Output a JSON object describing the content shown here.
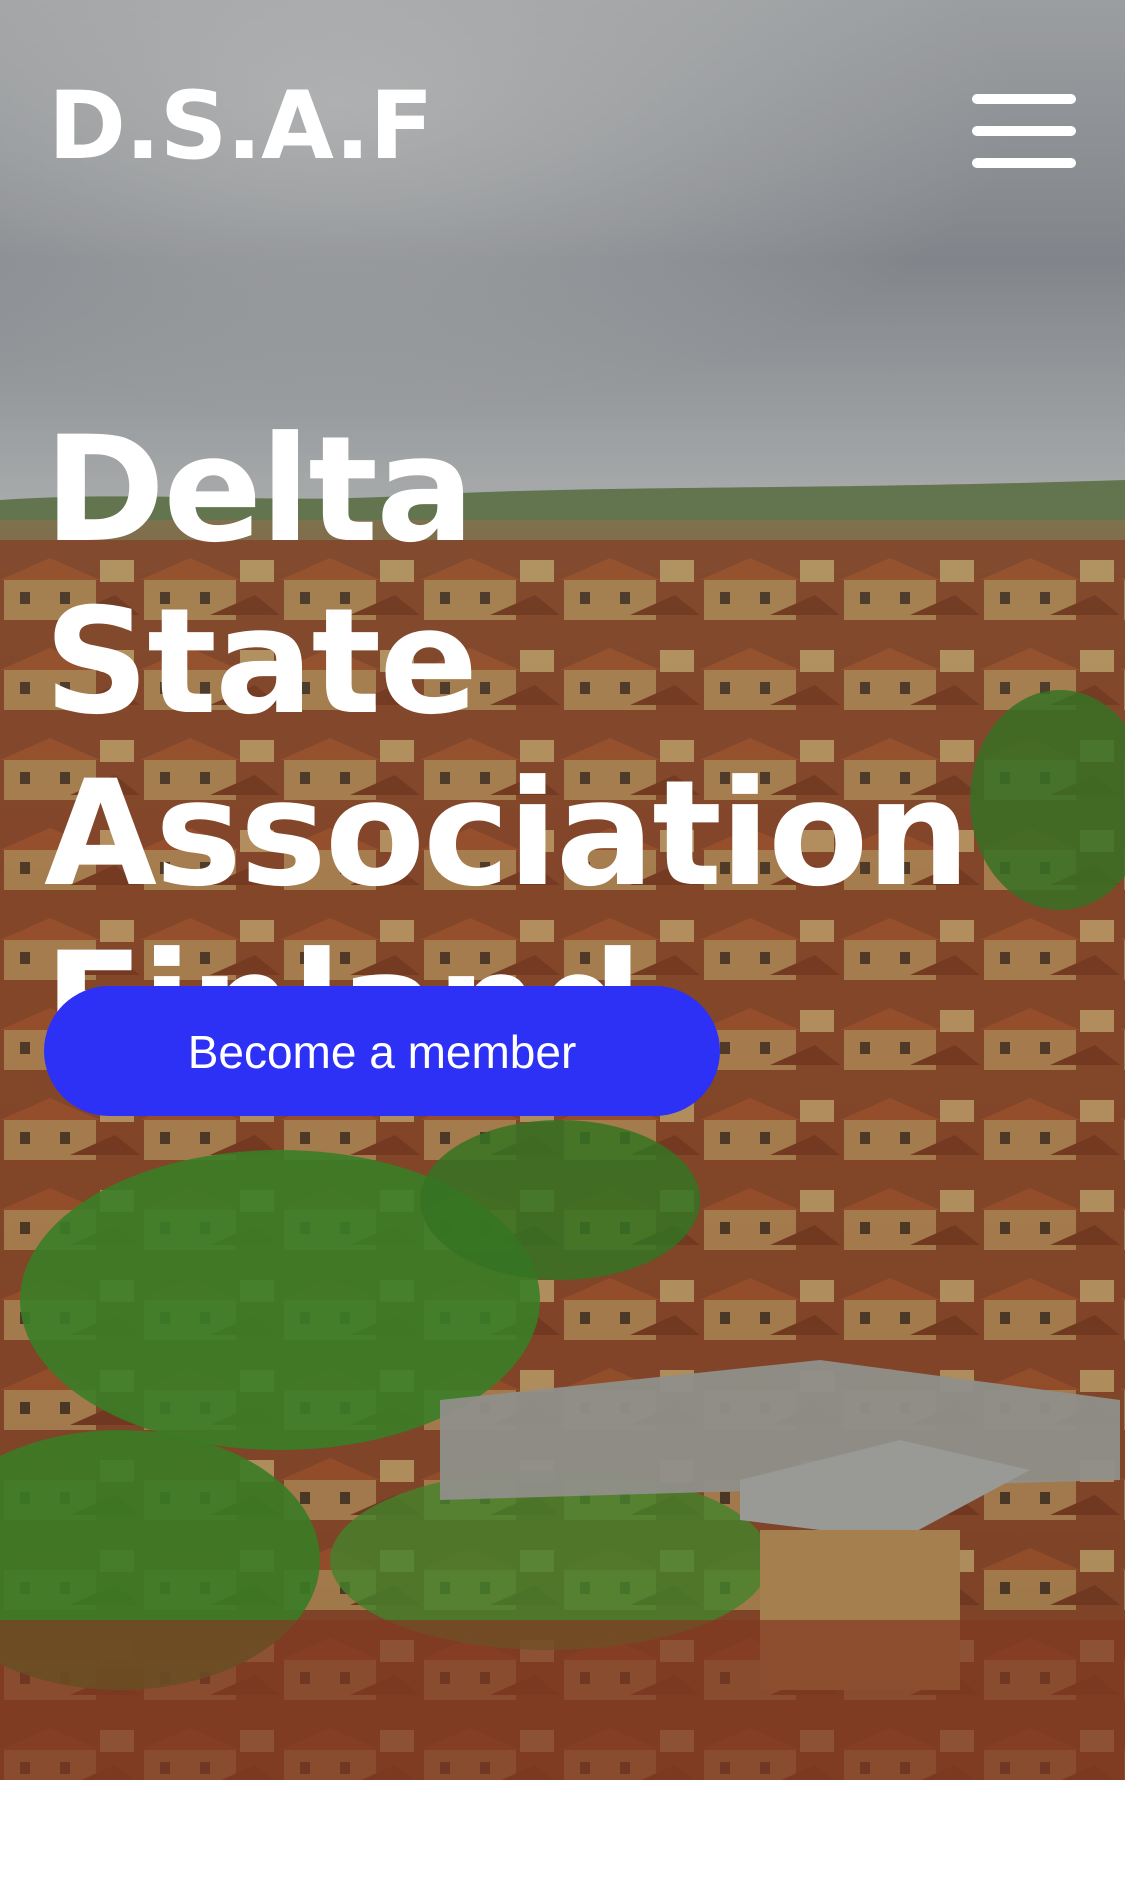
{
  "header": {
    "logo_text": "D.S.A.F",
    "menu_icon": "hamburger-menu-icon"
  },
  "hero": {
    "background": "aerial photograph of a town with rusty corrugated roofs, green trees and a cloudy grey sky",
    "title": "Delta State Association Finland",
    "cta_label": "Become a member"
  },
  "colors": {
    "accent": "#2d31f5",
    "text": "#ffffff",
    "page_background": "#ffffff"
  }
}
